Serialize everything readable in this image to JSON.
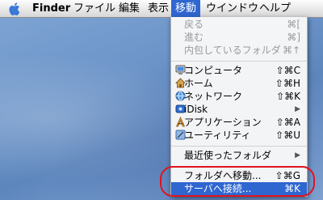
{
  "menubar": {
    "app": "Finder",
    "items": [
      "ファイル",
      "編集",
      "表示",
      "移動",
      "ウインドウ",
      "ヘルプ"
    ],
    "active": "移動"
  },
  "menu": {
    "back": {
      "label": "戻る",
      "shortcut": "⌘["
    },
    "forward": {
      "label": "進む",
      "shortcut": "⌘]"
    },
    "enclosing": {
      "label": "内包しているフォルダ",
      "shortcut": "⌘↑"
    },
    "computer": {
      "label": "コンピュータ",
      "shortcut": "⇧⌘C",
      "icon": "computer-icon"
    },
    "home": {
      "label": "ホーム",
      "shortcut": "⇧⌘H",
      "icon": "home-icon"
    },
    "network": {
      "label": "ネットワーク",
      "shortcut": "⇧⌘K",
      "icon": "network-icon"
    },
    "idisk": {
      "label": "iDisk",
      "icon": "idisk-icon"
    },
    "applications": {
      "label": "アプリケーション",
      "shortcut": "⇧⌘A",
      "icon": "applications-icon"
    },
    "utilities": {
      "label": "ユーティリティ",
      "shortcut": "⇧⌘U",
      "icon": "utilities-icon"
    },
    "recent": {
      "label": "最近使ったフォルダ"
    },
    "goto": {
      "label": "フォルダへ移動...",
      "shortcut": "⇧⌘G"
    },
    "connect": {
      "label": "サーバへ接続...",
      "shortcut": "⌘K"
    }
  },
  "colors": {
    "highlight": "#2f66d0",
    "annotation": "#e0141e"
  }
}
